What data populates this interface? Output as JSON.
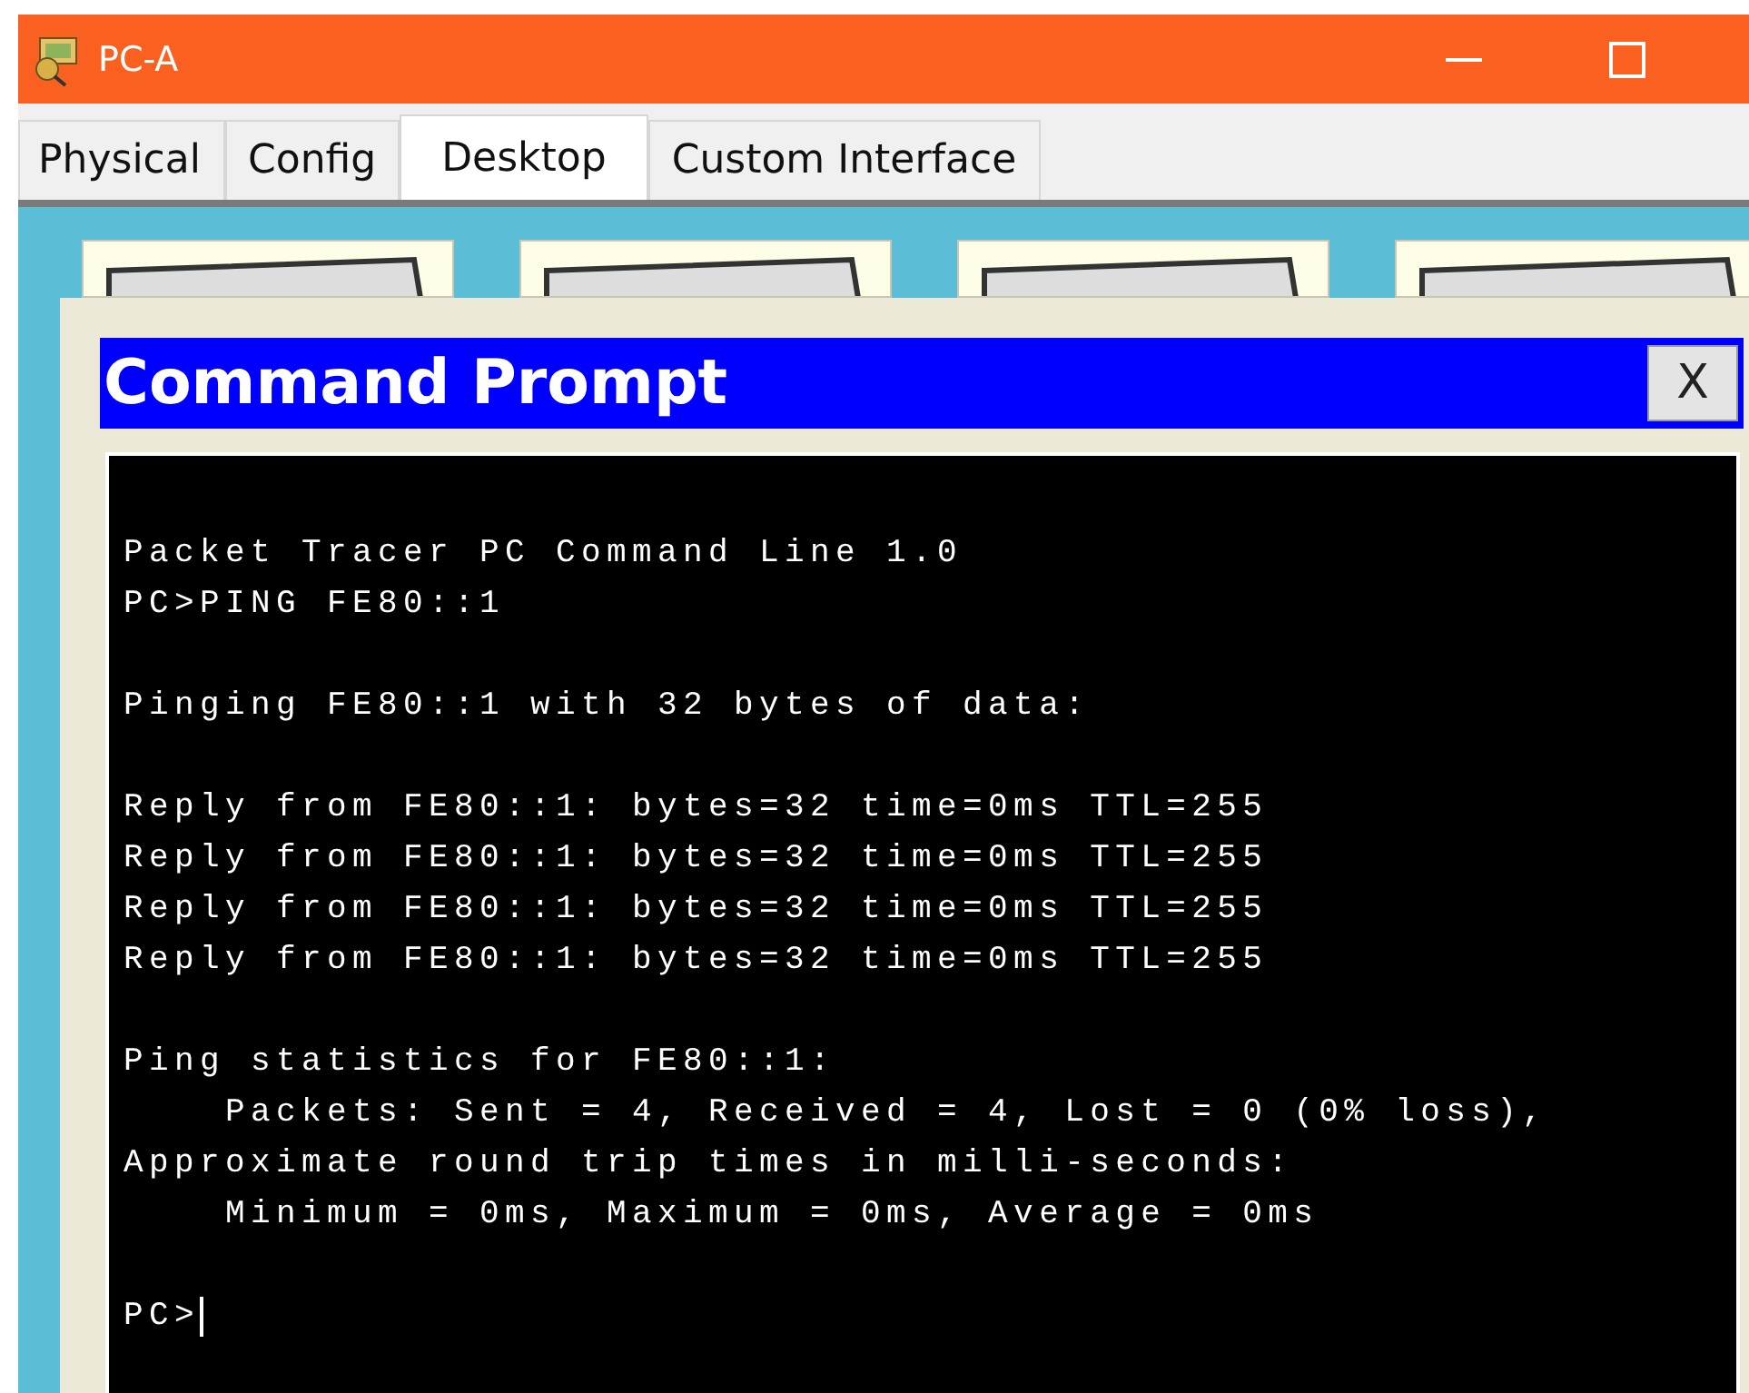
{
  "window": {
    "title": "PC-A"
  },
  "tabs": [
    {
      "label": "Physical",
      "selected": false
    },
    {
      "label": "Config",
      "selected": false
    },
    {
      "label": "Desktop",
      "selected": true
    },
    {
      "label": "Custom Interface",
      "selected": false
    }
  ],
  "dialog": {
    "title": "Command Prompt",
    "close": "X"
  },
  "terminal": {
    "blocks": [
      [
        "Packet Tracer PC Command Line 1.0",
        "PC>PING FE80::1"
      ],
      [
        "Pinging FE80::1 with 32 bytes of data:"
      ],
      [
        "Reply from FE80::1: bytes=32 time=0ms TTL=255",
        "Reply from FE80::1: bytes=32 time=0ms TTL=255",
        "Reply from FE80::1: bytes=32 time=0ms TTL=255",
        "Reply from FE80::1: bytes=32 time=0ms TTL=255"
      ],
      [
        "Ping statistics for FE80::1:",
        "    Packets: Sent = 4, Received = 4, Lost = 0 (0% loss),",
        "Approximate round trip times in milli-seconds:",
        "    Minimum = 0ms, Maximum = 0ms, Average = 0ms"
      ]
    ],
    "prompt": "PC>"
  }
}
